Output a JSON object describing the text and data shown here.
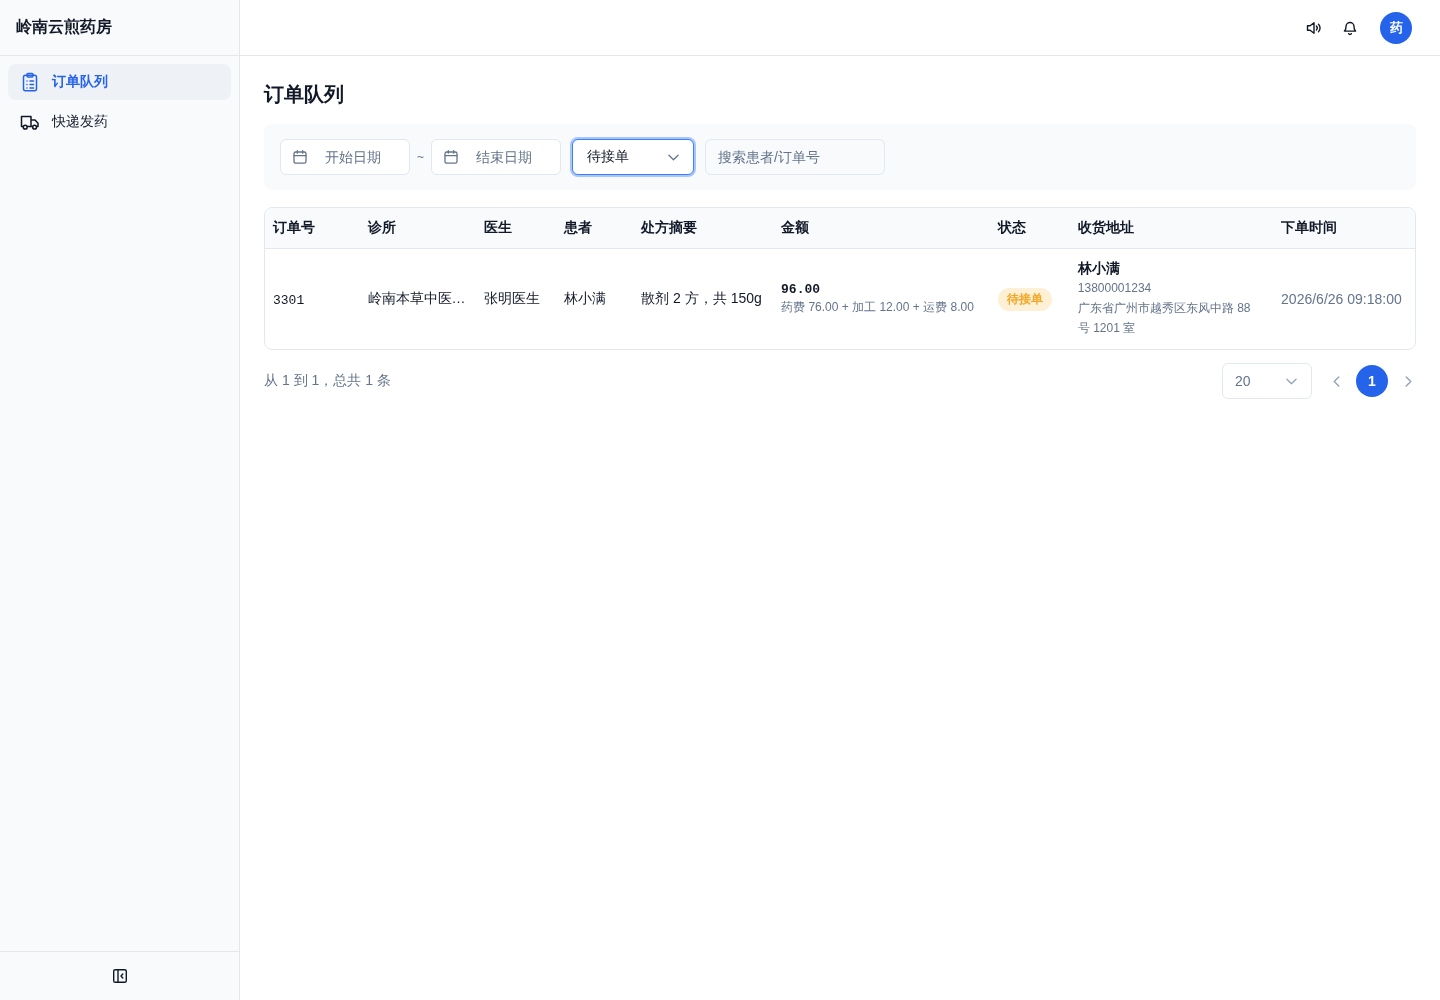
{
  "sidebar": {
    "brand": "岭南云煎药房",
    "items": [
      {
        "label": "订单队列",
        "kind": "clipboard",
        "selected": true
      },
      {
        "label": "快递发药",
        "kind": "truck",
        "selected": false
      }
    ]
  },
  "header": {
    "avatar": "药"
  },
  "page": {
    "title": "订单队列"
  },
  "filters": {
    "start_date": {
      "placeholder": "开始日期"
    },
    "separator": "~",
    "end_date": {
      "placeholder": "结束日期"
    },
    "status": {
      "value": "待接单",
      "focused": true
    },
    "search": {
      "placeholder": "搜索患者/订单号"
    }
  },
  "table": {
    "columns": [
      "订单号",
      "诊所",
      "医生",
      "患者",
      "处方摘要",
      "金额",
      "状态",
      "收货地址",
      "下单时间"
    ],
    "rows": [
      {
        "order_no": "3301",
        "clinic": "岭南本草中医…",
        "doctor": "张明医生",
        "patient": "林小满",
        "summary": "散剂 2 方，共 150g",
        "amount": "96.00",
        "amount_detail": "药费 76.00 + 加工 12.00 + 运费 8.00",
        "status": {
          "label": "待接单",
          "kind": "pending"
        },
        "recipient": "林小满",
        "phone": "13800001234",
        "address": "广东省广州市越秀区东风中路 88 号 1201 室",
        "time": "2026/6/26 09:18:00"
      }
    ]
  },
  "pagination": {
    "summary": "从 1 到 1，总共 1 条",
    "page_size": "20",
    "pages": [
      {
        "label": "1",
        "selected": true
      }
    ]
  }
}
